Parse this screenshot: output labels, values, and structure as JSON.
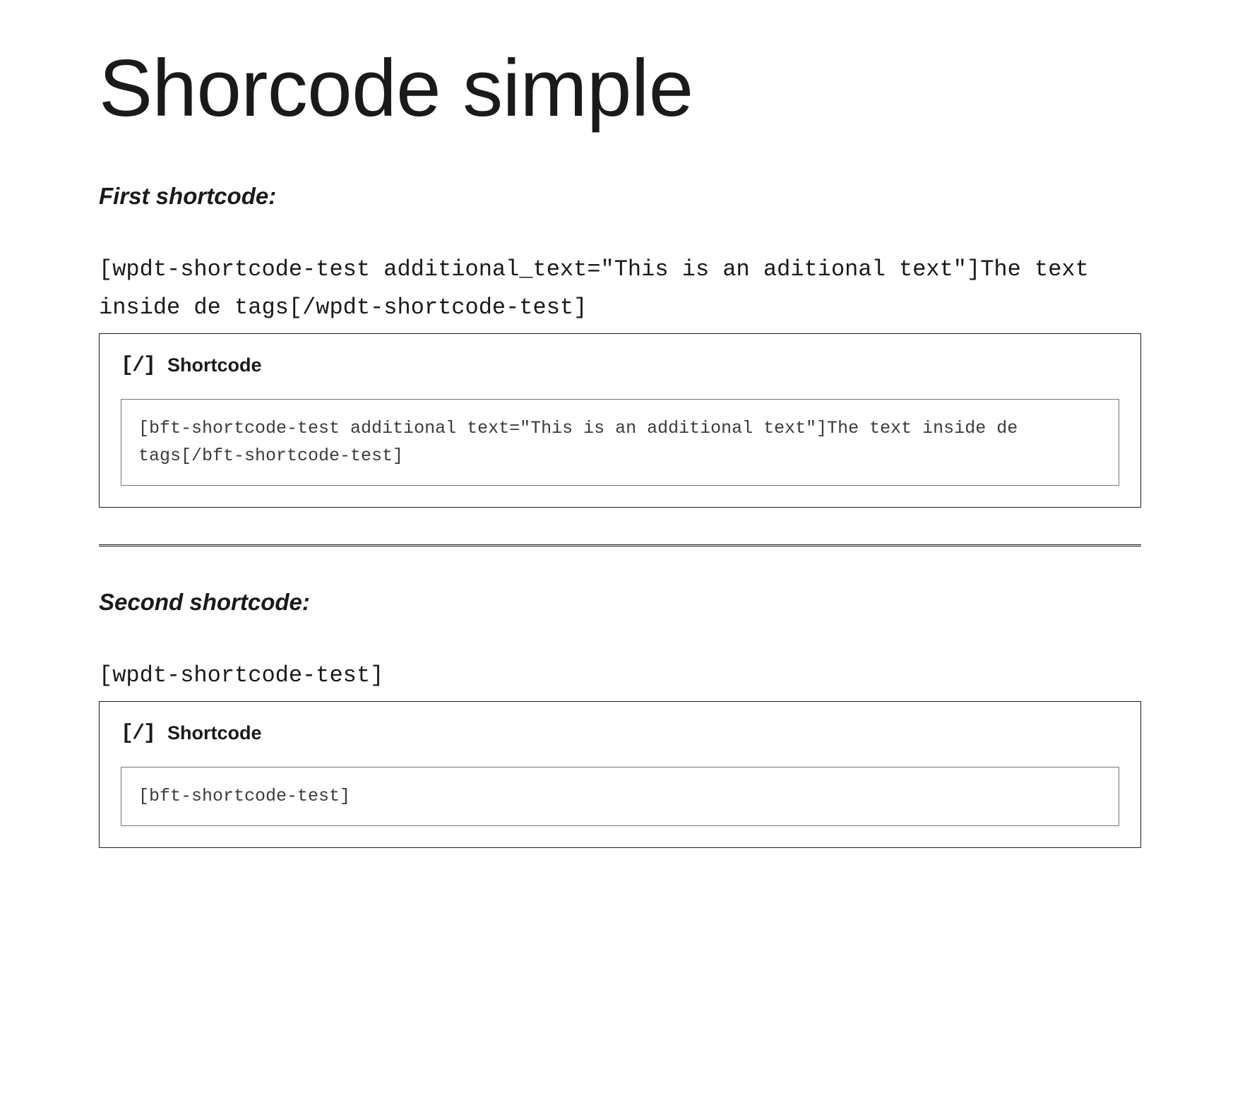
{
  "page": {
    "title": "Shorcode simple"
  },
  "sections": [
    {
      "heading": "First shortcode:",
      "outerCode": "[wpdt-shortcode-test additional_text=\"This is an aditional text\"]The text inside de tags[/wpdt-shortcode-test]",
      "block": {
        "icon": "[/]",
        "label": "Shortcode",
        "value": "[bft-shortcode-test additional text=\"This is an additional text\"]The text inside de tags[/bft-shortcode-test]"
      }
    },
    {
      "heading": "Second shortcode:",
      "outerCode": "[wpdt-shortcode-test]",
      "block": {
        "icon": "[/]",
        "label": "Shortcode",
        "value": "[bft-shortcode-test]"
      }
    }
  ]
}
